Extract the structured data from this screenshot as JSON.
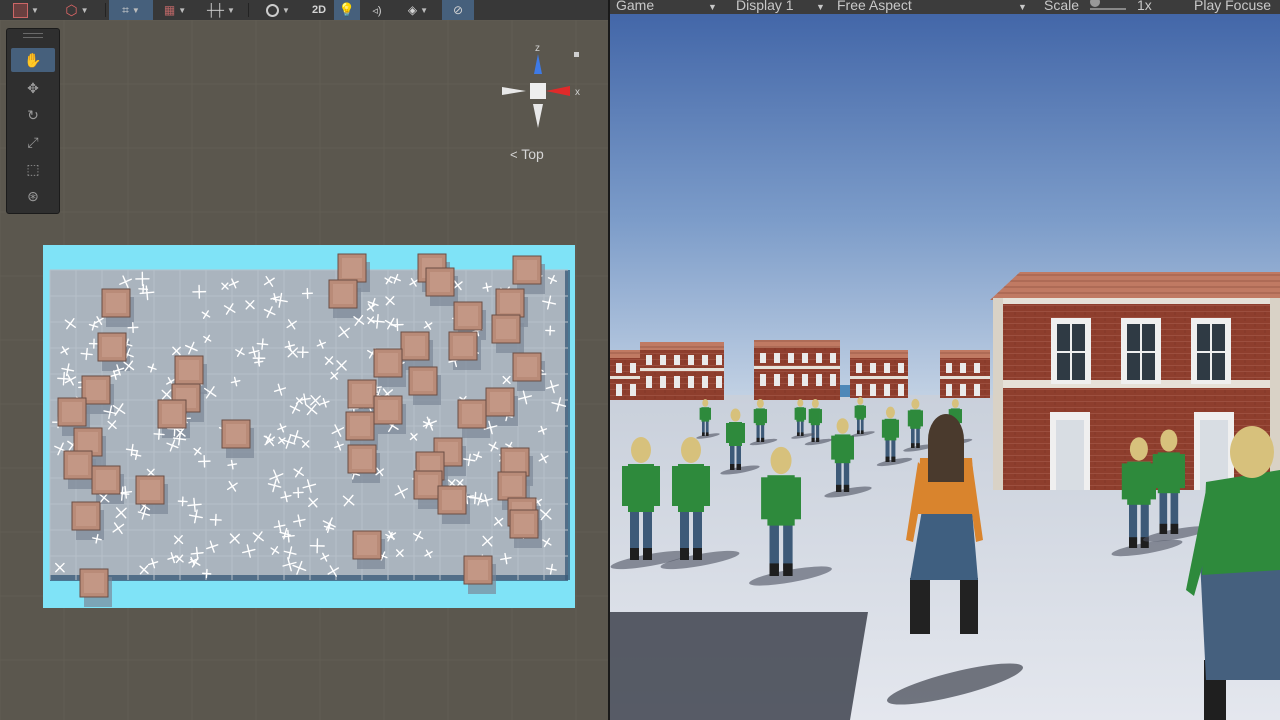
{
  "scene_toolbar": {
    "mode_2d_label": "2D"
  },
  "tools": [
    {
      "name": "hand-tool",
      "icon": "hand-icon",
      "active": true
    },
    {
      "name": "move-tool",
      "icon": "move-icon",
      "active": false
    },
    {
      "name": "rotate-tool",
      "icon": "rotate-icon",
      "active": false
    },
    {
      "name": "scale-tool",
      "icon": "scale-icon",
      "active": false
    },
    {
      "name": "rect-tool",
      "icon": "rect-icon",
      "active": false
    },
    {
      "name": "transform-tool",
      "icon": "transform-icon",
      "active": false
    }
  ],
  "gizmo": {
    "z_label": "z",
    "x_label": "x",
    "view_label": "Top"
  },
  "game_toolbar": {
    "tab_label": "Game",
    "display_label": "Display 1",
    "aspect_label": "Free Aspect",
    "scale_label": "Scale",
    "scale_value": "1x",
    "play_focus_label": "Play Focuse"
  },
  "colors": {
    "scene_bg": "#5b574e",
    "floor_border": "#7fe3f7",
    "floor": "#a9b3bd",
    "building_roof": "#b98b78",
    "sky_top": "#4668a8",
    "sky_bottom": "#b6c9de",
    "brick": "#8e3e2d",
    "agent_shirt": "#2e8a3c",
    "player_shirt": "#d9842d"
  }
}
